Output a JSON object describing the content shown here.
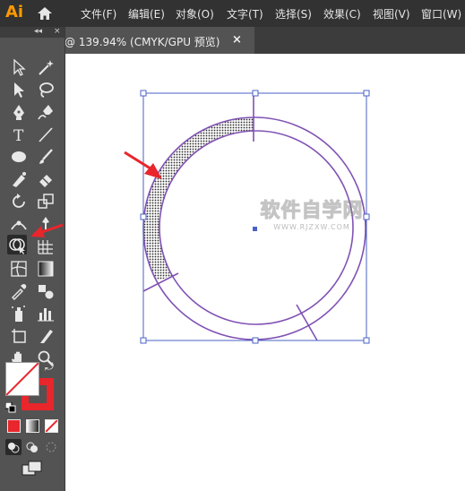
{
  "app": {
    "logo": "Ai"
  },
  "menu": {
    "items": [
      "文件(F)",
      "编辑(E)",
      "对象(O)",
      "文字(T)",
      "选择(S)",
      "效果(C)",
      "视图(V)",
      "窗口(W)"
    ]
  },
  "document": {
    "tab_title": "@ 139.94% (CMYK/GPU 预览)",
    "close_glyph": "×"
  },
  "toolbox": {
    "collapse_glyph": "◂◂"
  },
  "canvas": {
    "watermark": "软件自学网",
    "watermark_url": "WWW.RJZXW.COM"
  },
  "colors": {
    "accent_red": "#e8262c",
    "path_purple": "#8052b4",
    "selection_blue": "#4a62c6",
    "arrow_red": "#e8262c"
  }
}
